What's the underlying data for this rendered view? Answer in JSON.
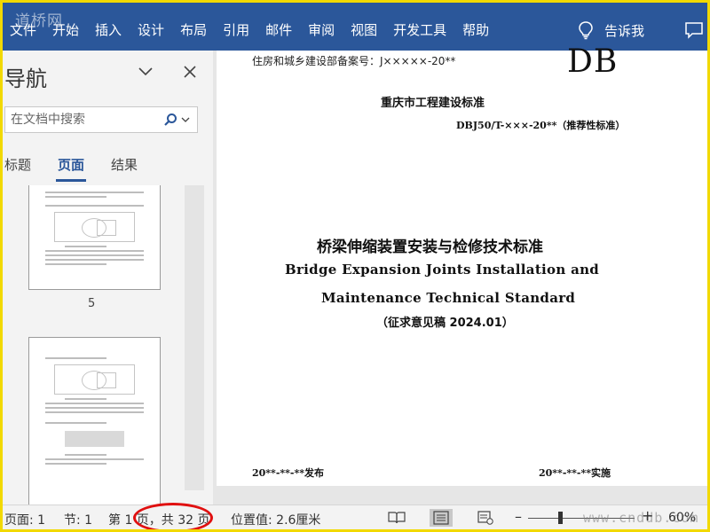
{
  "watermark_text": "道桥网",
  "ribbon": {
    "tabs": [
      "文件",
      "开始",
      "插入",
      "设计",
      "布局",
      "引用",
      "邮件",
      "审阅",
      "视图",
      "开发工具",
      "帮助"
    ],
    "tell_me": "告诉我"
  },
  "nav": {
    "title": "导航",
    "search_placeholder": "在文档中搜索",
    "tabs": [
      "标题",
      "页面",
      "结果"
    ],
    "active_tab": "页面",
    "thumb_page_number": "5"
  },
  "document": {
    "record_no": "住房和城乡建设部备案号：J×××××-20**",
    "db_mark": "DB",
    "std_title": "重庆市工程建设标准",
    "std_code": "DBJ50/T-×××-20**（推荐性标准）",
    "title_zh": "桥梁伸缩装置安装与检修技术标准",
    "title_en_line1": "Bridge Expansion Joints Installation and",
    "title_en_line2": "Maintenance Technical Standard",
    "draft": "（征求意见稿 2024.01）",
    "release": "20**-**-**发布",
    "implement": "20**-**-**实施"
  },
  "status": {
    "page": "页面: 1",
    "section": "节: 1",
    "page_count": "第 1 页，共 32 页",
    "position": "位置值: 2.6厘米",
    "zoom_minus": "–",
    "zoom_plus": "+",
    "zoom": "60%",
    "zoom_fraction": 0.3
  },
  "site_watermark": "www.cnddb.com",
  "colors": {
    "ribbon": "#2b579a",
    "frame": "#f2d900",
    "annotation": "#e01010"
  }
}
